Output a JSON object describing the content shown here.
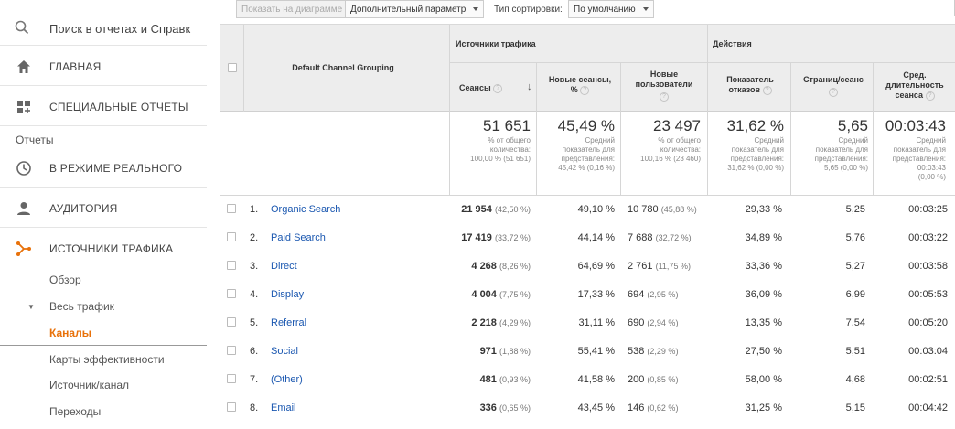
{
  "sidebar": {
    "search_placeholder": "Поиск в отчетах и Справк",
    "items": [
      {
        "label": "ГЛАВНАЯ",
        "icon": "home-icon"
      },
      {
        "label": "СПЕЦИАЛЬНЫЕ ОТЧЕТЫ",
        "icon": "custom-reports-icon"
      },
      {
        "label": "В РЕЖИМЕ РЕАЛЬНОГО",
        "icon": "clock-icon"
      },
      {
        "label": "АУДИТОРИЯ",
        "icon": "person-icon"
      },
      {
        "label": "ИСТОЧНИКИ ТРАФИКА",
        "icon": "acquisition-icon"
      }
    ],
    "section_label": "Отчеты",
    "sub_items": {
      "overview": "Обзор",
      "all_traffic": "Весь трафик",
      "channels": "Каналы",
      "treemaps": "Карты эффективности",
      "source_medium": "Источник/канал",
      "referrals": "Переходы"
    },
    "accent_color": "#e8710a"
  },
  "toolbar": {
    "plot_rows": "Показать на диаграмме",
    "secondary_dimension": "Дополнительный параметр",
    "sort_type_label": "Тип сортировки:",
    "sort_type_value": "По умолчанию"
  },
  "table": {
    "dimension_header": "Default Channel Grouping",
    "group_acquisition": "Источники трафика",
    "group_behavior": "Действия",
    "columns": {
      "sessions": "Сеансы",
      "new_sessions_1": "Новые сеансы,",
      "new_sessions_2": "%",
      "new_users_1": "Новые",
      "new_users_2": "пользователи",
      "bounce_1": "Показатель",
      "bounce_2": "отказов",
      "pages_session": "Страниц/сеанс",
      "duration_1": "Сред.",
      "duration_2": "длительность",
      "duration_3": "сеанса"
    },
    "totals": {
      "sessions": {
        "value": "51 651",
        "l1": "% от общего",
        "l2": "количества:",
        "l3": "100,00 % (51 651)"
      },
      "new_sessions": {
        "value": "45,49 %",
        "l1": "Средний",
        "l2": "показатель для",
        "l3": "представления:",
        "l4": "45,42 % (0,16 %)"
      },
      "new_users": {
        "value": "23 497",
        "l1": "% от общего",
        "l2": "количества:",
        "l3": "100,16 % (23 460)"
      },
      "bounce": {
        "value": "31,62 %",
        "l1": "Средний",
        "l2": "показатель для",
        "l3": "представления:",
        "l4": "31,62 % (0,00 %)"
      },
      "pages": {
        "value": "5,65",
        "l1": "Средний",
        "l2": "показатель для",
        "l3": "представления:",
        "l4": "5,65 (0,00 %)"
      },
      "duration": {
        "value": "00:03:43",
        "l1": "Средний",
        "l2": "показатель для",
        "l3": "представления:",
        "l4": "00:03:43",
        "l5": "(0,00 %)"
      }
    },
    "rows": [
      {
        "idx": "1.",
        "name": "Organic Search",
        "sessions": "21 954",
        "sessions_pct": "(42,50 %)",
        "new_sessions": "49,10 %",
        "new_users": "10 780",
        "new_users_pct": "(45,88 %)",
        "bounce": "29,33 %",
        "pages": "5,25",
        "duration": "00:03:25"
      },
      {
        "idx": "2.",
        "name": "Paid Search",
        "sessions": "17 419",
        "sessions_pct": "(33,72 %)",
        "new_sessions": "44,14 %",
        "new_users": "7 688",
        "new_users_pct": "(32,72 %)",
        "bounce": "34,89 %",
        "pages": "5,76",
        "duration": "00:03:22"
      },
      {
        "idx": "3.",
        "name": "Direct",
        "sessions": "4 268",
        "sessions_pct": "(8,26 %)",
        "new_sessions": "64,69 %",
        "new_users": "2 761",
        "new_users_pct": "(11,75 %)",
        "bounce": "33,36 %",
        "pages": "5,27",
        "duration": "00:03:58"
      },
      {
        "idx": "4.",
        "name": "Display",
        "sessions": "4 004",
        "sessions_pct": "(7,75 %)",
        "new_sessions": "17,33 %",
        "new_users": "694",
        "new_users_pct": "(2,95 %)",
        "bounce": "36,09 %",
        "pages": "6,99",
        "duration": "00:05:53"
      },
      {
        "idx": "5.",
        "name": "Referral",
        "sessions": "2 218",
        "sessions_pct": "(4,29 %)",
        "new_sessions": "31,11 %",
        "new_users": "690",
        "new_users_pct": "(2,94 %)",
        "bounce": "13,35 %",
        "pages": "7,54",
        "duration": "00:05:20"
      },
      {
        "idx": "6.",
        "name": "Social",
        "sessions": "971",
        "sessions_pct": "(1,88 %)",
        "new_sessions": "55,41 %",
        "new_users": "538",
        "new_users_pct": "(2,29 %)",
        "bounce": "27,50 %",
        "pages": "5,51",
        "duration": "00:03:04"
      },
      {
        "idx": "7.",
        "name": "(Other)",
        "sessions": "481",
        "sessions_pct": "(0,93 %)",
        "new_sessions": "41,58 %",
        "new_users": "200",
        "new_users_pct": "(0,85 %)",
        "bounce": "58,00 %",
        "pages": "4,68",
        "duration": "00:02:51"
      },
      {
        "idx": "8.",
        "name": "Email",
        "sessions": "336",
        "sessions_pct": "(0,65 %)",
        "new_sessions": "43,45 %",
        "new_users": "146",
        "new_users_pct": "(0,62 %)",
        "bounce": "31,25 %",
        "pages": "5,15",
        "duration": "00:04:42"
      }
    ],
    "link_color": "#1a57b0"
  }
}
